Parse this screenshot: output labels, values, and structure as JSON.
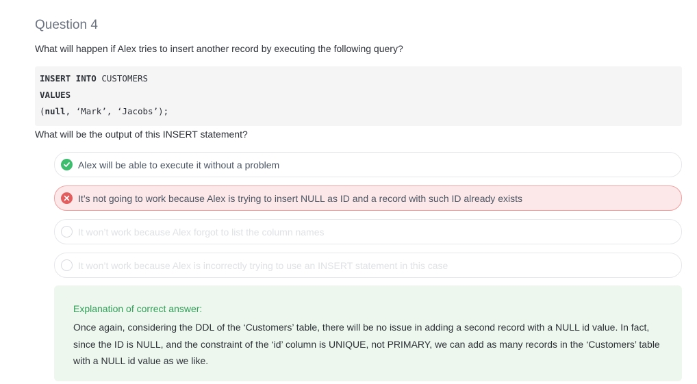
{
  "question": {
    "title": "Question 4",
    "prompt": "What will happen if Alex tries to insert another record by executing the following query?",
    "code": {
      "line1_kw": "INSERT INTO",
      "line1_rest": " CUSTOMERS",
      "line2": "VALUES",
      "line3_open": "(",
      "line3_kw": "null",
      "line3_rest": ", ‘Mark’, ‘Jacobs’);"
    },
    "sub_prompt": "What will be the output of this INSERT statement?"
  },
  "options": [
    {
      "label": "Alex will be able to execute it without a problem",
      "state": "correct",
      "icon": "check-circle-icon"
    },
    {
      "label": "It’s not going to work because Alex is trying to insert NULL as ID and a record with such ID already exists",
      "state": "wrong",
      "icon": "x-circle-icon"
    },
    {
      "label": "It won’t work because Alex forgot to list the column names",
      "state": "unselected",
      "icon": "empty-circle-icon"
    },
    {
      "label": "It won’t work because Alex is incorrectly trying to use an INSERT statement in this case",
      "state": "unselected",
      "icon": "empty-circle-icon"
    }
  ],
  "explanation": {
    "title": "Explanation of correct answer:",
    "body": "Once again, considering the DDL of the ‘Customers’ table, there will be no issue in adding a second record with a NULL id value. In fact, since the ID is NULL, and the constraint of the ‘id’ column is UNIQUE, not PRIMARY, we can add as many records in the ‘Customers’ table with a NULL id value as we like."
  },
  "colors": {
    "correct": "#3dbd6d",
    "wrong": "#e25d5d",
    "wrong_bg": "#fce8e8",
    "explanation_bg": "#edf7ed",
    "explanation_title": "#2f9e57"
  }
}
